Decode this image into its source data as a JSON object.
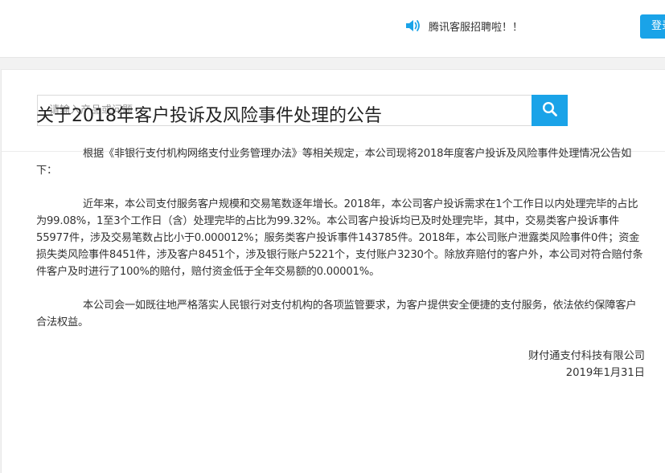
{
  "header": {
    "notice_icon": "speaker-icon",
    "notice_text": "腾讯客服招聘啦！！",
    "login_label": "登录",
    "accent_color": "#1aa3e8"
  },
  "search": {
    "placeholder": "请输入产品或问题",
    "button_icon": "search-icon"
  },
  "article": {
    "title": "关于2018年客户投诉及风险事件处理的公告",
    "paragraphs": [
      "根据《非银行支付机构网络支付业务管理办法》等相关规定，本公司现将2018年度客户投诉及风险事件处理情况公告如下：",
      "近年来，本公司支付服务客户规模和交易笔数逐年增长。2018年，本公司客户投诉需求在1个工作日以内处理完毕的占比为99.08%，1至3个工作日（含）处理完毕的占比为99.32%。本公司客户投诉均已及时处理完毕，其中，交易类客户投诉事件55977件，涉及交易笔数占比小于0.000012%；服务类客户投诉事件143785件。2018年，本公司账户泄露类风险事件0件；资金损失类风险事件8451件，涉及客户8451个，涉及银行账户5221个，支付账户3230个。除放弃赔付的客户外，本公司对符合赔付条件客户及时进行了100%的赔付，赔付资金低于全年交易额的0.00001%。",
      "本公司会一如既往地严格落实人民银行对支付机构的各项监管要求，为客户提供安全便捷的支付服务，依法依约保障客户合法权益。"
    ],
    "signature_company": "财付通支付科技有限公司",
    "signature_date": "2019年1月31日"
  }
}
